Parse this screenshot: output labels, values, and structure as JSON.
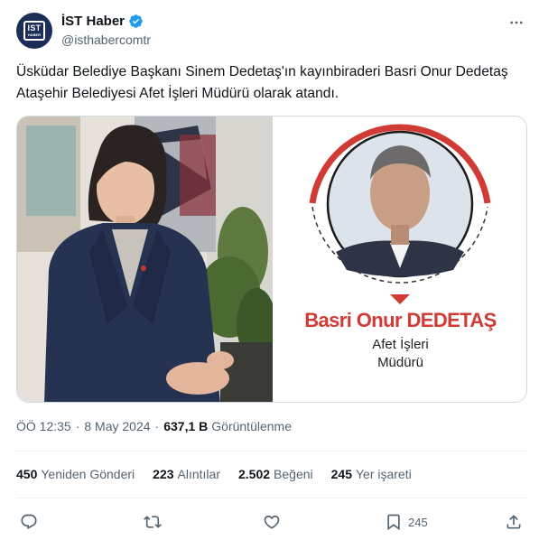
{
  "author": {
    "avatar_text_top": "IST",
    "avatar_text_bottom": "HABER",
    "name": "İST Haber",
    "handle": "@isthabercomtr",
    "verified": true
  },
  "tweet": {
    "text": "Üsküdar Belediye Başkanı Sinem Dedetaş'ın kayınbiraderi Basri Onur Dedetaş Ataşehir Belediyesi Afet İşleri Müdürü olarak atandı."
  },
  "media": {
    "caption_name": "Basri Onur DEDETAŞ",
    "caption_title_line1": "Afet İşleri",
    "caption_title_line2": "Müdürü",
    "accent_color": "#d03c35"
  },
  "meta": {
    "time": "ÖÖ 12:35",
    "separator": "·",
    "date": "8 May 2024",
    "views_count": "637,1 B",
    "views_label": "Görüntülenme"
  },
  "stats": [
    {
      "count": "450",
      "label": "Yeniden Gönderi"
    },
    {
      "count": "223",
      "label": "Alıntılar"
    },
    {
      "count": "2.502",
      "label": "Beğeni"
    },
    {
      "count": "245",
      "label": "Yer işareti"
    }
  ],
  "actions": {
    "reply_icon": "reply-icon",
    "retweet_icon": "retweet-icon",
    "like_icon": "like-icon",
    "bookmark_icon": "bookmark-icon",
    "bookmark_count": "245",
    "share_icon": "share-icon"
  }
}
